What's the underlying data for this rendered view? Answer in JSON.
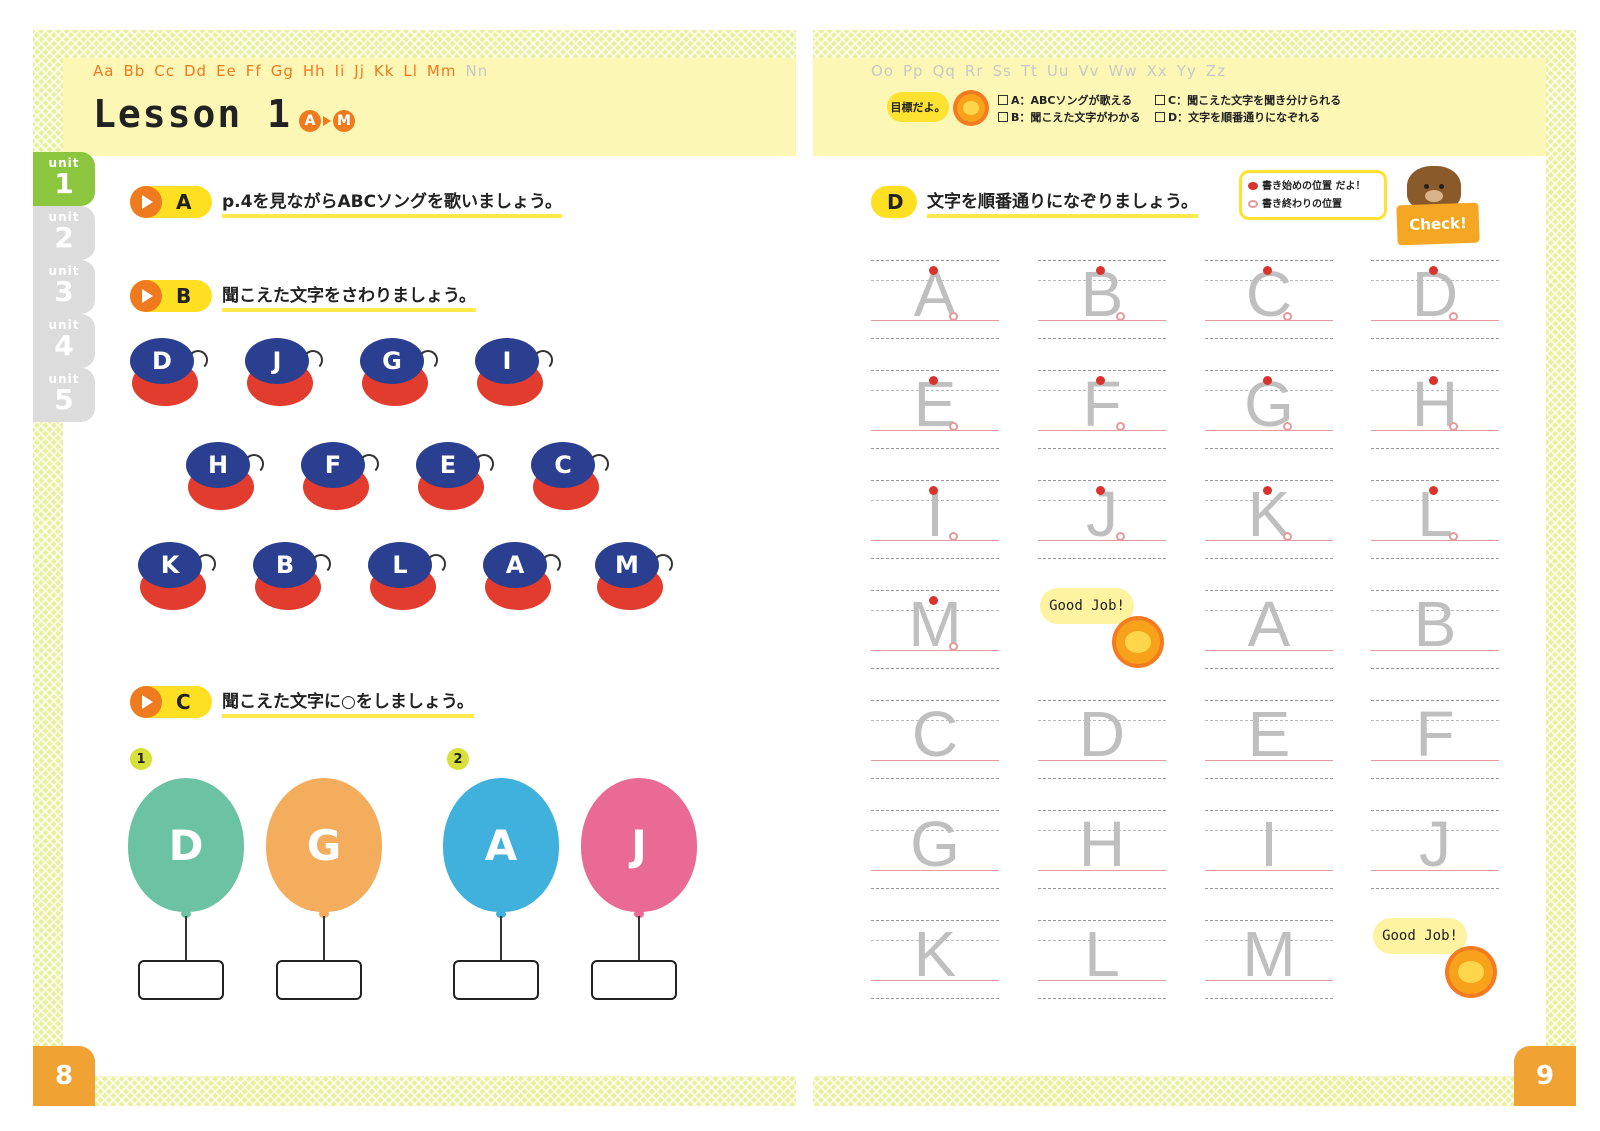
{
  "left": {
    "alphabet": [
      {
        "pair": "Aa",
        "color": "#f07a1e"
      },
      {
        "pair": "Bb",
        "color": "#f07a1e"
      },
      {
        "pair": "Cc",
        "color": "#f07a1e"
      },
      {
        "pair": "Dd",
        "color": "#f07a1e"
      },
      {
        "pair": "Ee",
        "color": "#f07a1e"
      },
      {
        "pair": "Ff",
        "color": "#f07a1e"
      },
      {
        "pair": "Gg",
        "color": "#f07a1e"
      },
      {
        "pair": "Hh",
        "color": "#f07a1e"
      },
      {
        "pair": "Ii",
        "color": "#f07a1e"
      },
      {
        "pair": "Jj",
        "color": "#f07a1e"
      },
      {
        "pair": "Kk",
        "color": "#f07a1e"
      },
      {
        "pair": "Ll",
        "color": "#f07a1e"
      },
      {
        "pair": "Mm",
        "color": "#f07a1e"
      },
      {
        "pair": "Nn",
        "color": "#c8c8c8"
      }
    ],
    "lesson_title": "Lesson 1",
    "range_start": "A",
    "range_end": "M",
    "unit_label": "unit",
    "units": [
      "1",
      "2",
      "3",
      "4",
      "5"
    ],
    "active_unit": "1",
    "page_number": "8",
    "task_a": {
      "letter": "A",
      "text": "p.4を見ながらABCソングを歌いましょう。"
    },
    "task_b": {
      "letter": "B",
      "text": "聞こえた文字をさわりましょう。"
    },
    "task_c": {
      "letter": "C",
      "text": "聞こえた文字に○をしましょう。"
    },
    "castanets": [
      "D",
      "J",
      "G",
      "I",
      "H",
      "F",
      "E",
      "C",
      "K",
      "B",
      "L",
      "A",
      "M"
    ],
    "question_1": "1",
    "question_2": "2",
    "balloons": [
      {
        "letter": "D",
        "color": "#6cc3a3"
      },
      {
        "letter": "G",
        "color": "#f4ad5d"
      },
      {
        "letter": "A",
        "color": "#3fb1dc"
      },
      {
        "letter": "J",
        "color": "#e86a95"
      }
    ]
  },
  "right": {
    "alphabet": [
      "Oo",
      "Pp",
      "Qq",
      "Rr",
      "Ss",
      "Tt",
      "Uu",
      "Vv",
      "Ww",
      "Xx",
      "Yy",
      "Zz"
    ],
    "goal_label": "目標だよ。",
    "goals": [
      "A：ABCソングが歌える",
      "B：聞こえた文字がわかる",
      "C：聞こえた文字を聞き分けられる",
      "D：文字を順番通りになぞれる"
    ],
    "task_d": {
      "letter": "D",
      "text": "文字を順番通りになぞりましょう。"
    },
    "legend_start": "書き始めの位置",
    "legend_end": "書き終わりの位置",
    "legend_suffix": "だよ！",
    "check_label": "Check!",
    "trace_letters": [
      "A",
      "B",
      "C",
      "D",
      "E",
      "F",
      "G",
      "H",
      "I",
      "J",
      "K",
      "L",
      "M"
    ],
    "practice_letters": [
      "A",
      "B",
      "C",
      "D",
      "E",
      "F",
      "G",
      "H",
      "I",
      "J",
      "K",
      "L",
      "M"
    ],
    "good_job": "Good Job!",
    "page_number": "9"
  }
}
